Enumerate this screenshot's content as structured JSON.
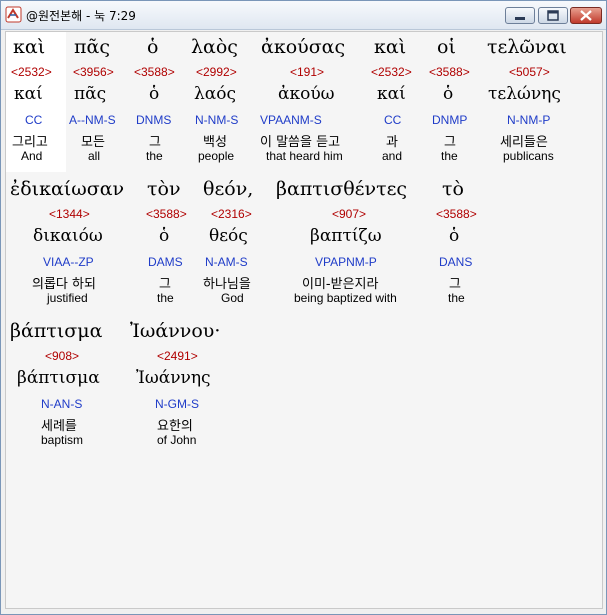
{
  "window": {
    "title": "@원전본해 - 눅 7:29",
    "minimize_label": "minimize",
    "maximize_label": "maximize",
    "close_label": "close"
  },
  "words": [
    {
      "greek": "καὶ",
      "strong": "<2532>",
      "lemma": "καί",
      "parse": "CC",
      "korean": "그리고",
      "english": "And"
    },
    {
      "greek": "πᾶς",
      "strong": "<3956>",
      "lemma": "πᾶς",
      "parse": "A--NM-S",
      "korean": "모든",
      "english": "all"
    },
    {
      "greek": "ὁ",
      "strong": "<3588>",
      "lemma": "ὁ",
      "parse": "DNMS",
      "korean": "그",
      "english": "the"
    },
    {
      "greek": "λαὸς",
      "strong": "<2992>",
      "lemma": "λαός",
      "parse": "N-NM-S",
      "korean": "백성",
      "english": "people"
    },
    {
      "greek": "ἀκούσας",
      "strong": "<191>",
      "lemma": "ἀκούω",
      "parse": "VPAANM-S",
      "korean": "이 말씀을 듣고",
      "english": "that heard him"
    },
    {
      "greek": "καὶ",
      "strong": "<2532>",
      "lemma": "καί",
      "parse": "CC",
      "korean": "과",
      "english": "and"
    },
    {
      "greek": "οἱ",
      "strong": "<3588>",
      "lemma": "ὁ",
      "parse": "DNMP",
      "korean": "그",
      "english": "the"
    },
    {
      "greek": "τελῶναι",
      "strong": "<5057>",
      "lemma": "τελώνης",
      "parse": "N-NM-P",
      "korean": "세리들은",
      "english": "publicans"
    },
    {
      "greek": "ἐδικαίωσαν",
      "strong": "<1344>",
      "lemma": "δικαιόω",
      "parse": "VIAA--ZP",
      "korean": "의롭다 하되",
      "english": "justified"
    },
    {
      "greek": "τὸν",
      "strong": "<3588>",
      "lemma": "ὁ",
      "parse": "DAMS",
      "korean": "그",
      "english": "the"
    },
    {
      "greek": "θεόν,",
      "strong": "<2316>",
      "lemma": "θεός",
      "parse": "N-AM-S",
      "korean": "하나님을",
      "english": "God"
    },
    {
      "greek": "βαπτισθέντες",
      "strong": "<907>",
      "lemma": "βαπτίζω",
      "parse": "VPAPNM-P",
      "korean": "이미-받은지라",
      "english": "being baptized with"
    },
    {
      "greek": "τὸ",
      "strong": "<3588>",
      "lemma": "ὁ",
      "parse": "DANS",
      "korean": "그",
      "english": "the"
    },
    {
      "greek": "βάπτισμα",
      "strong": "<908>",
      "lemma": "βάπτισμα",
      "parse": "N-AN-S",
      "korean": "세례를",
      "english": "baptism"
    },
    {
      "greek": "Ἰωάννου·",
      "strong": "<2491>",
      "lemma": "Ἰωάννης",
      "parse": "N-GM-S",
      "korean": "요한의",
      "english": "of John"
    }
  ]
}
